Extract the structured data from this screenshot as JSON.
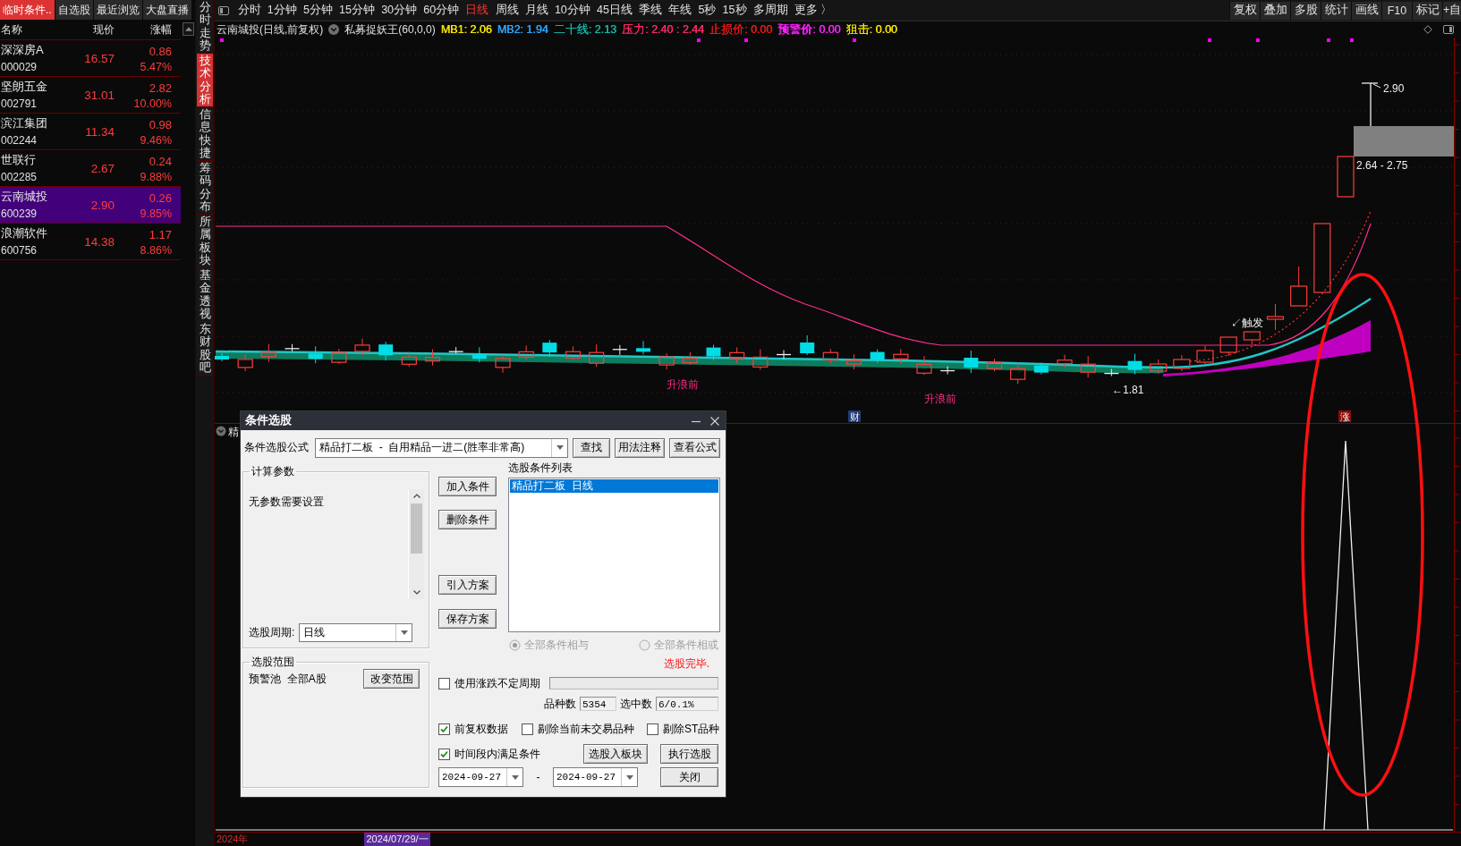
{
  "stock_list": {
    "tabs": [
      {
        "label": "临时条件..",
        "selected": true
      },
      {
        "label": "自选股",
        "selected": false
      },
      {
        "label": "最近浏览",
        "selected": false
      },
      {
        "label": "大盘直播",
        "selected": false
      }
    ],
    "columns": [
      "名称",
      "现价",
      "涨幅"
    ],
    "rows": [
      {
        "name": "深深房A",
        "code": "000029",
        "price": "16.57",
        "change": "0.86",
        "change_pct": "5.47%",
        "selected": false
      },
      {
        "name": "坚朗五金",
        "code": "002791",
        "price": "31.01",
        "change": "2.82",
        "change_pct": "10.00%",
        "selected": false
      },
      {
        "name": "滨江集团",
        "code": "002244",
        "price": "11.34",
        "change": "0.98",
        "change_pct": "9.46%",
        "selected": false
      },
      {
        "name": "世联行",
        "code": "002285",
        "price": "2.67",
        "change": "0.24",
        "change_pct": "9.88%",
        "selected": false
      },
      {
        "name": "云南城投",
        "code": "600239",
        "price": "2.90",
        "change": "0.26",
        "change_pct": "9.85%",
        "selected": true
      },
      {
        "name": "浪潮软件",
        "code": "600756",
        "price": "14.38",
        "change": "1.17",
        "change_pct": "8.86%",
        "selected": false
      }
    ]
  },
  "view_tabs": [
    {
      "label": "分时走势",
      "selected": false
    },
    {
      "label": "技术分析",
      "selected": true
    },
    {
      "label": "信息快捷",
      "selected": false
    },
    {
      "label": "筹码分布",
      "selected": false
    },
    {
      "label": "所属板块",
      "selected": false
    },
    {
      "label": "基金透视",
      "selected": false
    },
    {
      "label": "东财股吧",
      "selected": false
    }
  ],
  "period_bar": {
    "periods": [
      {
        "label": "分时",
        "selected": false
      },
      {
        "label": "1分钟",
        "selected": false
      },
      {
        "label": "5分钟",
        "selected": false
      },
      {
        "label": "15分钟",
        "selected": false
      },
      {
        "label": "30分钟",
        "selected": false
      },
      {
        "label": "60分钟",
        "selected": false
      },
      {
        "label": "日线",
        "selected": true
      },
      {
        "label": "周线",
        "selected": false
      },
      {
        "label": "月线",
        "selected": false
      },
      {
        "label": "10分钟",
        "selected": false
      },
      {
        "label": "45日线",
        "selected": false
      },
      {
        "label": "季线",
        "selected": false
      },
      {
        "label": "年线",
        "selected": false
      },
      {
        "label": "5秒",
        "selected": false
      },
      {
        "label": "15秒",
        "selected": false
      },
      {
        "label": "多周期",
        "selected": false
      },
      {
        "label": "更多 〉",
        "selected": false
      }
    ],
    "tools": [
      "复权",
      "叠加",
      "多股",
      "统计",
      "画线",
      "F10",
      "标记",
      "+自"
    ]
  },
  "chart_header": {
    "title": "云南城投(日线,前复权)",
    "formula": "私募捉妖王(60,0,0)",
    "indicators": [
      {
        "text": "MB1: 2.06",
        "color": "#f5e400"
      },
      {
        "text": "MB2: 1.94",
        "color": "#2ea8ff"
      },
      {
        "text": "二十线: 2.13",
        "color": "#12b8a8"
      },
      {
        "text": "压力: 2.40 : 2.44",
        "color": "#ff2a6a"
      },
      {
        "text": "止损价: 0.00",
        "color": "#f01818"
      },
      {
        "text": "预警价: 0.00",
        "color": "#ff22ff"
      },
      {
        "text": "狙击: 0.00",
        "color": "#f5e400"
      }
    ]
  },
  "price_chart": {
    "wave_labels": [
      "升浪前",
      "升浪前"
    ],
    "trigger_label": "↙触发",
    "low_label": "←1.81",
    "high_label": "2.90",
    "zone_label": "2.64 - 2.75",
    "event_badges": [
      {
        "text": "财",
        "kind": "finance"
      },
      {
        "text": "涨",
        "kind": "rise"
      }
    ]
  },
  "indicator_pane": {
    "title": "精"
  },
  "time_axis": [
    {
      "kind": "year",
      "text": "2024年"
    },
    {
      "kind": "cursor",
      "text": "2024/07/29/一"
    }
  ],
  "dialog": {
    "title": "条件选股",
    "formula": {
      "label": "条件选股公式",
      "value": "精品打二板  -  自用精品一进二(胜率非常高)"
    },
    "top_buttons": [
      "查找",
      "用法注释",
      "查看公式"
    ],
    "params": {
      "title": "计算参数",
      "note": "无参数需要设置",
      "period_label": "选股周期:",
      "period_value": "日线"
    },
    "scope": {
      "title": "选股范围",
      "value": "预警池  全部A股",
      "button": "改变范围"
    },
    "action_buttons": [
      "加入条件",
      "删除条件",
      "引入方案",
      "保存方案"
    ],
    "conditions": {
      "title": "选股条件列表",
      "items": [
        {
          "text": "精品打二板  日线",
          "selected": true
        }
      ]
    },
    "logic": {
      "disabled": true,
      "options": [
        {
          "label": "全部条件相与",
          "selected": true
        },
        {
          "label": "全部条件相或",
          "selected": false
        }
      ]
    },
    "status": "选股完毕.",
    "variable_period": {
      "label": "使用涨跌不定周期",
      "checked": false
    },
    "progress": {
      "level": 0
    },
    "counts": [
      {
        "label": "品种数",
        "value": "5354"
      },
      {
        "label": "选中数",
        "value": "6/0.1%"
      }
    ],
    "filters": [
      {
        "label": "前复权数据",
        "checked": true
      },
      {
        "label": "剔除当前未交易品种",
        "checked": false
      },
      {
        "label": "剔除ST品种",
        "checked": false
      }
    ],
    "time_range": {
      "label": "时间段内满足条件",
      "checked": true,
      "start": "2024-09-27",
      "separator": "-",
      "end": "2024-09-27"
    },
    "bottom_buttons": [
      "选股入板块",
      "执行选股",
      "关闭"
    ]
  }
}
